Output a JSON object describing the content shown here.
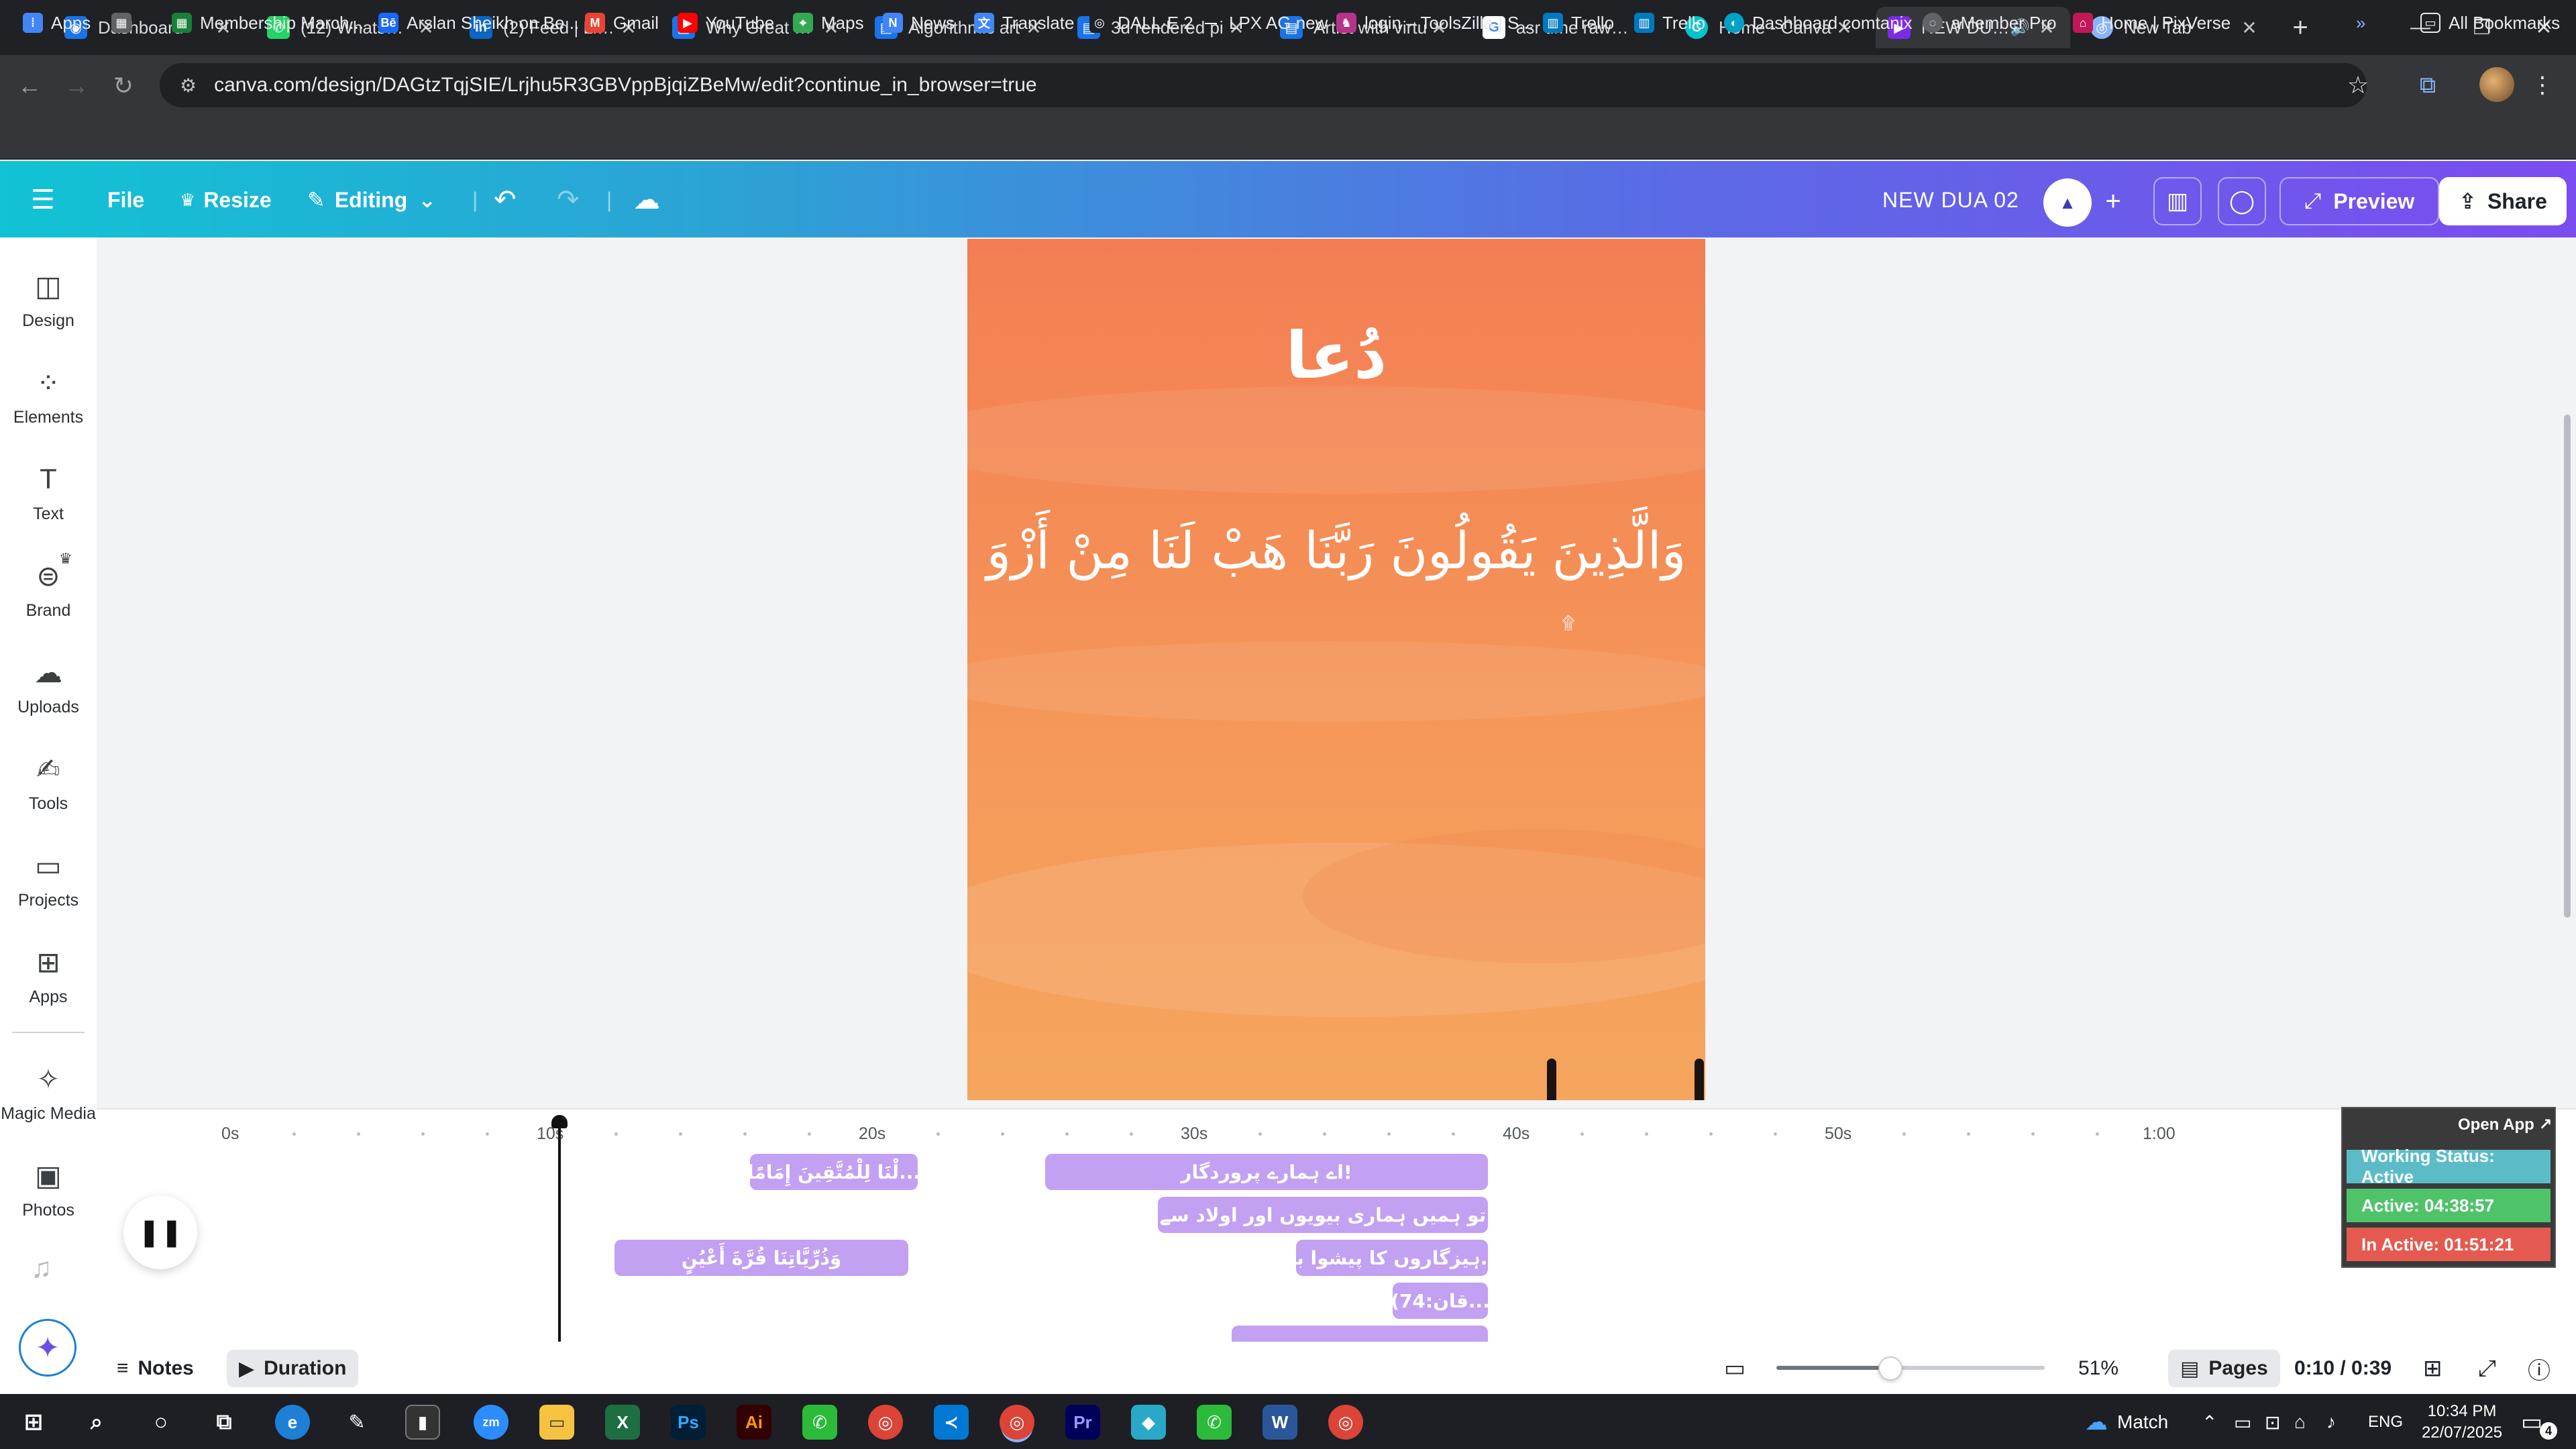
{
  "browser": {
    "tabs": [
      {
        "title": "Dashboard",
        "icon": "globe",
        "color": "#1a73e8"
      },
      {
        "title": "(12) WhatsApp",
        "icon": "whatsapp",
        "color": "#25d366"
      },
      {
        "title": "(2) Feed | LinkedIn",
        "icon": "linkedin",
        "color": "#0a66c2"
      },
      {
        "title": "Why Great Graphic",
        "icon": "doc",
        "color": "#1a73e8"
      },
      {
        "title": "Algorithmic art",
        "icon": "doc",
        "color": "#1a73e8"
      },
      {
        "title": "3d rendered pi",
        "icon": "doc",
        "color": "#1a73e8"
      },
      {
        "title": "Artist with virtu",
        "icon": "doc",
        "color": "#1a73e8"
      },
      {
        "title": "asr time rawalp",
        "icon": "google",
        "color": "#ffffff"
      },
      {
        "title": "Home - Canva",
        "icon": "canva",
        "color": "#00c4cc"
      },
      {
        "title": "NEW DUA 0",
        "icon": "canva-doc",
        "color": "#7d2ae8"
      },
      {
        "title": "New Tab",
        "icon": "chrome",
        "color": "#8ab4f8"
      }
    ],
    "url": "canva.com/design/DAGtzTqjSIE/Lrjhu5R3GBVppBjqiZBeMw/edit?continue_in_browser=true",
    "bookmarks": [
      {
        "label": "Apps",
        "color": "#4285f4"
      },
      {
        "label": "",
        "color": "#5f6368"
      },
      {
        "label": "Membership March...",
        "color": "#188038"
      },
      {
        "label": "Arslan Sheikh on Be...",
        "color": "#1769ff"
      },
      {
        "label": "Gmail",
        "color": "#ea4335"
      },
      {
        "label": "YouTube",
        "color": "#ff0000"
      },
      {
        "label": "Maps",
        "color": "#34a853"
      },
      {
        "label": "News",
        "color": "#4285f4"
      },
      {
        "label": "Translate",
        "color": "#4285f4"
      },
      {
        "label": "DALL·E 2",
        "color": "#202124"
      },
      {
        "label": "LPX AG new",
        "color": "#5f6368"
      },
      {
        "label": "login – ToolsZilla | S...",
        "color": "#b5338a"
      },
      {
        "label": "Trello",
        "color": "#0079bf"
      },
      {
        "label": "Trello",
        "color": "#0079bf"
      },
      {
        "label": "Dashboard comtanix",
        "color": "#00a1c9"
      },
      {
        "label": "aMember Pro",
        "color": "#5f6368"
      },
      {
        "label": "Home | PixVerse",
        "color": "#c2185b"
      }
    ],
    "all_bookmarks": "All Bookmarks"
  },
  "canva_header": {
    "file": "File",
    "resize": "Resize",
    "editing": "Editing",
    "doc_title": "NEW DUA 02",
    "preview": "Preview",
    "share": "Share"
  },
  "sidebar": {
    "items": [
      {
        "label": "Design",
        "icon": "layout-icon"
      },
      {
        "label": "Elements",
        "icon": "shapes-icon"
      },
      {
        "label": "Text",
        "icon": "text-icon"
      },
      {
        "label": "Brand",
        "icon": "brand-icon"
      },
      {
        "label": "Uploads",
        "icon": "upload-icon"
      },
      {
        "label": "Tools",
        "icon": "pen-icon"
      },
      {
        "label": "Projects",
        "icon": "folder-icon"
      },
      {
        "label": "Apps",
        "icon": "apps-icon"
      },
      {
        "label": "Magic Media",
        "icon": "magic-media-icon"
      },
      {
        "label": "Photos",
        "icon": "photo-icon"
      }
    ]
  },
  "design": {
    "title_arabic": "دُعا",
    "verse_arabic": "وَالَّذِينَ يَقُولُونَ رَبَّنَا هَبْ لَنَا مِنْ أَزْوَ",
    "small_mark": "۩"
  },
  "timeline": {
    "ticks": [
      "0s",
      "10s",
      "20s",
      "30s",
      "40s",
      "50s",
      "1:00"
    ],
    "clips_row1": [
      {
        "text": "...لْنَا لِلْمُتَّقِينَ إِمَامًا"
      },
      {
        "text": "!اے ہمارے پروردگار"
      }
    ],
    "clips_row2": [
      {
        "text": "تو ہمیں ہماری بیویوں اور اولاد سے"
      }
    ],
    "clips_row3": [
      {
        "text": "وَذُرِّيَّاتِنَا قُرَّةَ أَعْيُنٍ"
      },
      {
        "text": "...ہیزگاروں کا پیشوا بنا"
      }
    ],
    "clips_row4": [
      {
        "text": "...قان:74)"
      }
    ]
  },
  "bottom_bar": {
    "notes": "Notes",
    "duration": "Duration",
    "zoom": "51%",
    "pages": "Pages",
    "time": "0:10 / 0:39"
  },
  "tracker": {
    "open_app": "Open App ↗",
    "working_status": "Working Status: Active",
    "active": "Active: 04:38:57",
    "inactive": "In Active: 01:51:21",
    "colors": {
      "status": "#5bbcc8",
      "active": "#4fc36a",
      "inactive": "#e55a50"
    }
  },
  "taskbar": {
    "weather": "Match",
    "lang": "ENG",
    "time": "10:34 PM",
    "date": "22/07/2025",
    "notif_count": "4"
  }
}
